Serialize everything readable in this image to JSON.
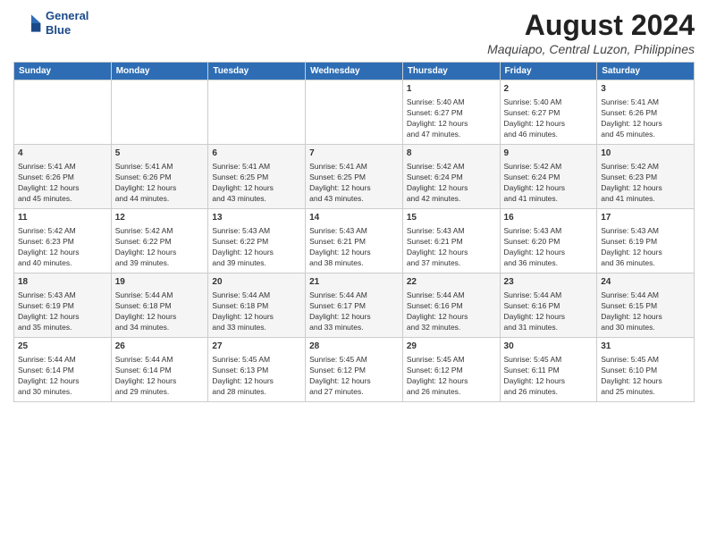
{
  "logo": {
    "line1": "General",
    "line2": "Blue"
  },
  "title": "August 2024",
  "subtitle": "Maquiapo, Central Luzon, Philippines",
  "days_header": [
    "Sunday",
    "Monday",
    "Tuesday",
    "Wednesday",
    "Thursday",
    "Friday",
    "Saturday"
  ],
  "weeks": [
    [
      {
        "num": "",
        "info": ""
      },
      {
        "num": "",
        "info": ""
      },
      {
        "num": "",
        "info": ""
      },
      {
        "num": "",
        "info": ""
      },
      {
        "num": "1",
        "info": "Sunrise: 5:40 AM\nSunset: 6:27 PM\nDaylight: 12 hours\nand 47 minutes."
      },
      {
        "num": "2",
        "info": "Sunrise: 5:40 AM\nSunset: 6:27 PM\nDaylight: 12 hours\nand 46 minutes."
      },
      {
        "num": "3",
        "info": "Sunrise: 5:41 AM\nSunset: 6:26 PM\nDaylight: 12 hours\nand 45 minutes."
      }
    ],
    [
      {
        "num": "4",
        "info": "Sunrise: 5:41 AM\nSunset: 6:26 PM\nDaylight: 12 hours\nand 45 minutes."
      },
      {
        "num": "5",
        "info": "Sunrise: 5:41 AM\nSunset: 6:26 PM\nDaylight: 12 hours\nand 44 minutes."
      },
      {
        "num": "6",
        "info": "Sunrise: 5:41 AM\nSunset: 6:25 PM\nDaylight: 12 hours\nand 43 minutes."
      },
      {
        "num": "7",
        "info": "Sunrise: 5:41 AM\nSunset: 6:25 PM\nDaylight: 12 hours\nand 43 minutes."
      },
      {
        "num": "8",
        "info": "Sunrise: 5:42 AM\nSunset: 6:24 PM\nDaylight: 12 hours\nand 42 minutes."
      },
      {
        "num": "9",
        "info": "Sunrise: 5:42 AM\nSunset: 6:24 PM\nDaylight: 12 hours\nand 41 minutes."
      },
      {
        "num": "10",
        "info": "Sunrise: 5:42 AM\nSunset: 6:23 PM\nDaylight: 12 hours\nand 41 minutes."
      }
    ],
    [
      {
        "num": "11",
        "info": "Sunrise: 5:42 AM\nSunset: 6:23 PM\nDaylight: 12 hours\nand 40 minutes."
      },
      {
        "num": "12",
        "info": "Sunrise: 5:42 AM\nSunset: 6:22 PM\nDaylight: 12 hours\nand 39 minutes."
      },
      {
        "num": "13",
        "info": "Sunrise: 5:43 AM\nSunset: 6:22 PM\nDaylight: 12 hours\nand 39 minutes."
      },
      {
        "num": "14",
        "info": "Sunrise: 5:43 AM\nSunset: 6:21 PM\nDaylight: 12 hours\nand 38 minutes."
      },
      {
        "num": "15",
        "info": "Sunrise: 5:43 AM\nSunset: 6:21 PM\nDaylight: 12 hours\nand 37 minutes."
      },
      {
        "num": "16",
        "info": "Sunrise: 5:43 AM\nSunset: 6:20 PM\nDaylight: 12 hours\nand 36 minutes."
      },
      {
        "num": "17",
        "info": "Sunrise: 5:43 AM\nSunset: 6:19 PM\nDaylight: 12 hours\nand 36 minutes."
      }
    ],
    [
      {
        "num": "18",
        "info": "Sunrise: 5:43 AM\nSunset: 6:19 PM\nDaylight: 12 hours\nand 35 minutes."
      },
      {
        "num": "19",
        "info": "Sunrise: 5:44 AM\nSunset: 6:18 PM\nDaylight: 12 hours\nand 34 minutes."
      },
      {
        "num": "20",
        "info": "Sunrise: 5:44 AM\nSunset: 6:18 PM\nDaylight: 12 hours\nand 33 minutes."
      },
      {
        "num": "21",
        "info": "Sunrise: 5:44 AM\nSunset: 6:17 PM\nDaylight: 12 hours\nand 33 minutes."
      },
      {
        "num": "22",
        "info": "Sunrise: 5:44 AM\nSunset: 6:16 PM\nDaylight: 12 hours\nand 32 minutes."
      },
      {
        "num": "23",
        "info": "Sunrise: 5:44 AM\nSunset: 6:16 PM\nDaylight: 12 hours\nand 31 minutes."
      },
      {
        "num": "24",
        "info": "Sunrise: 5:44 AM\nSunset: 6:15 PM\nDaylight: 12 hours\nand 30 minutes."
      }
    ],
    [
      {
        "num": "25",
        "info": "Sunrise: 5:44 AM\nSunset: 6:14 PM\nDaylight: 12 hours\nand 30 minutes."
      },
      {
        "num": "26",
        "info": "Sunrise: 5:44 AM\nSunset: 6:14 PM\nDaylight: 12 hours\nand 29 minutes."
      },
      {
        "num": "27",
        "info": "Sunrise: 5:45 AM\nSunset: 6:13 PM\nDaylight: 12 hours\nand 28 minutes."
      },
      {
        "num": "28",
        "info": "Sunrise: 5:45 AM\nSunset: 6:12 PM\nDaylight: 12 hours\nand 27 minutes."
      },
      {
        "num": "29",
        "info": "Sunrise: 5:45 AM\nSunset: 6:12 PM\nDaylight: 12 hours\nand 26 minutes."
      },
      {
        "num": "30",
        "info": "Sunrise: 5:45 AM\nSunset: 6:11 PM\nDaylight: 12 hours\nand 26 minutes."
      },
      {
        "num": "31",
        "info": "Sunrise: 5:45 AM\nSunset: 6:10 PM\nDaylight: 12 hours\nand 25 minutes."
      }
    ]
  ]
}
